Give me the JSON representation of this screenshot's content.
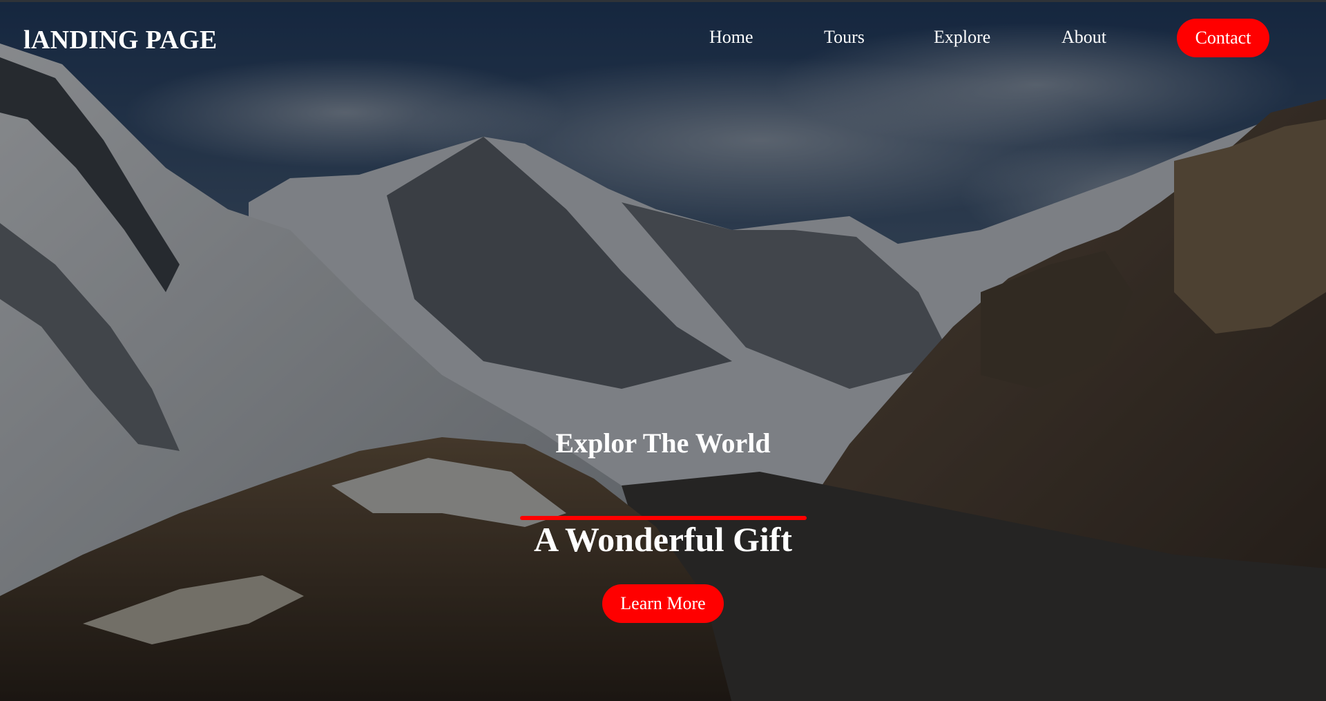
{
  "brand": {
    "logo_text": "lANDING PAGE"
  },
  "nav": {
    "items": [
      {
        "label": "Home"
      },
      {
        "label": "Tours"
      },
      {
        "label": "Explore"
      },
      {
        "label": "About"
      }
    ],
    "contact_label": "Contact"
  },
  "hero": {
    "subtitle": "Explor The World",
    "title": "A Wonderful Gift",
    "cta_label": "Learn More",
    "background": "snowy-mountain-valley-photo"
  },
  "colors": {
    "accent": "#ff0000",
    "text": "#ffffff",
    "overlay": "#000000"
  }
}
